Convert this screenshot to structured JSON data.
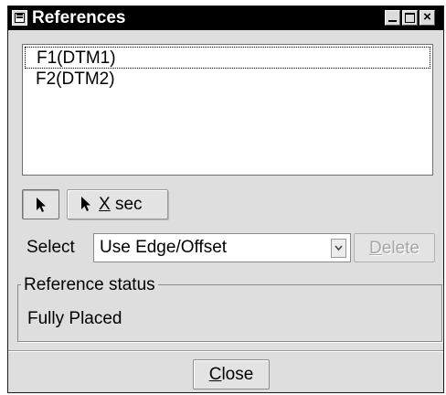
{
  "window": {
    "title": "References",
    "minimize_icon": "minimize-icon",
    "maximize_icon": "maximize-icon",
    "close_icon": "close-icon"
  },
  "references_list": {
    "items": [
      "F1(DTM1)",
      "F2(DTM2)"
    ],
    "focused_index": 0
  },
  "toolbar": {
    "select_icon": "arrow-pointer-icon",
    "xsec_mnemonic": "X",
    "xsec_rest": " sec"
  },
  "select_row": {
    "label": "Select",
    "value": "Use Edge/Offset",
    "delete_mnemonic": "D",
    "delete_rest": "elete",
    "delete_enabled": false
  },
  "reference_status": {
    "group_label": "Reference status",
    "value": "Fully Placed"
  },
  "footer": {
    "close_mnemonic": "C",
    "close_rest": "lose"
  },
  "colors": {
    "titlebar": "#000000",
    "window_bg": "#dedede",
    "disabled_text": "#a6a6a6"
  }
}
